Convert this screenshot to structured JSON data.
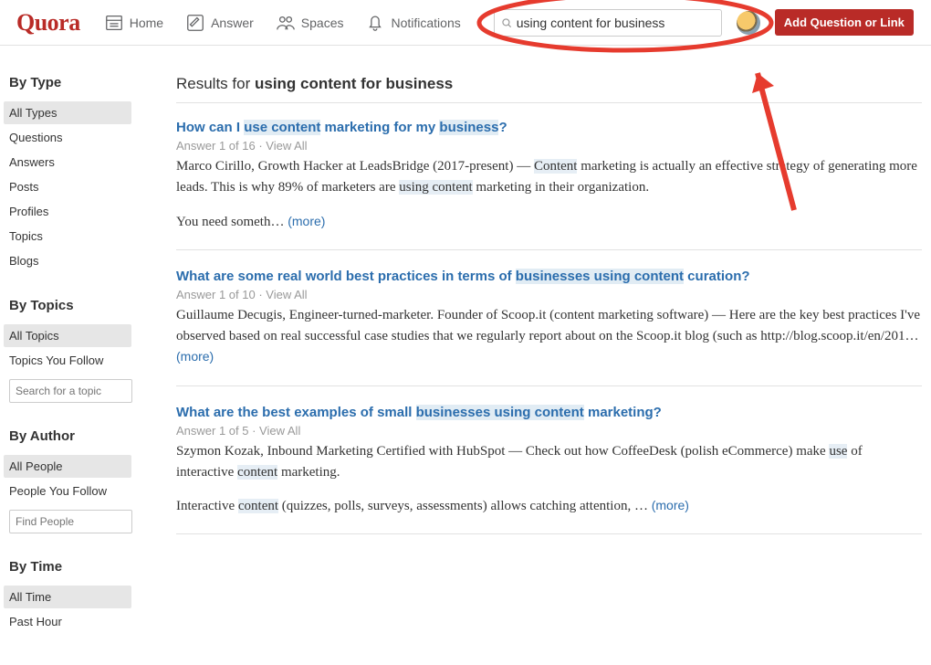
{
  "brand": "Quora",
  "nav": {
    "home": "Home",
    "answer": "Answer",
    "spaces": "Spaces",
    "notifications": "Notifications"
  },
  "search": {
    "value": "using content for business"
  },
  "cta_label": "Add Question or Link",
  "sidebar": {
    "by_type": {
      "heading": "By Type",
      "items": [
        "All Types",
        "Questions",
        "Answers",
        "Posts",
        "Profiles",
        "Topics",
        "Blogs"
      ],
      "active_index": 0
    },
    "by_topics": {
      "heading": "By Topics",
      "items": [
        "All Topics",
        "Topics You Follow"
      ],
      "active_index": 0,
      "input_placeholder": "Search for a topic"
    },
    "by_author": {
      "heading": "By Author",
      "items": [
        "All People",
        "People You Follow"
      ],
      "active_index": 0,
      "input_placeholder": "Find People"
    },
    "by_time": {
      "heading": "By Time",
      "items": [
        "All Time",
        "Past Hour"
      ],
      "active_index": 0
    }
  },
  "results": {
    "prefix": "Results for ",
    "query": "using content for business",
    "items": [
      {
        "title_parts": [
          "How can I ",
          "use content",
          " marketing for my ",
          "business",
          "?"
        ],
        "title_hl": [
          1,
          3
        ],
        "meta": "Answer 1 of 16",
        "view_all": "View All",
        "byline": "Marco Cirillo, Growth Hacker at LeadsBridge (2017-present)  — ",
        "body_parts": [
          "Content",
          " marketing is actually an effective strategy of generating more leads. This is why 89% of marketers are ",
          "using content",
          " marketing in their organization."
        ],
        "body_hl": [
          0,
          2
        ],
        "body2": "You need someth… ",
        "more": "(more)"
      },
      {
        "title_parts": [
          "What are some real world best practices in terms of ",
          "businesses using content",
          " curation?"
        ],
        "title_hl": [
          1
        ],
        "meta": "Answer 1 of 10",
        "view_all": "View All",
        "byline": "Guillaume Decugis, Engineer-turned-marketer. Founder of Scoop.it (content marketing software)  —  ",
        "body_parts": [
          "Here are the key best practices I've observed based on real successful case studies that we regularly report about on the Scoop.it blog (such as http://blog.scoop.it/en/201… "
        ],
        "body_hl": [],
        "body2": "",
        "more": "(more)"
      },
      {
        "title_parts": [
          "What are the best examples of small ",
          "businesses using content",
          " marketing?"
        ],
        "title_hl": [
          1
        ],
        "meta": "Answer 1 of 5",
        "view_all": "View All",
        "byline": "Szymon Kozak, Inbound Marketing Certified with HubSpot  — ",
        "body_parts": [
          "Check out how CoffeeDesk (polish eCommerce) make ",
          "use",
          " of interactive ",
          "content",
          " marketing."
        ],
        "body_hl": [
          1,
          3
        ],
        "body2_parts": [
          "Interactive ",
          "content",
          " (quizzes, polls, surveys, assessments) allows catching attention, … "
        ],
        "body2_hl": [
          1
        ],
        "more": "(more)"
      }
    ]
  }
}
